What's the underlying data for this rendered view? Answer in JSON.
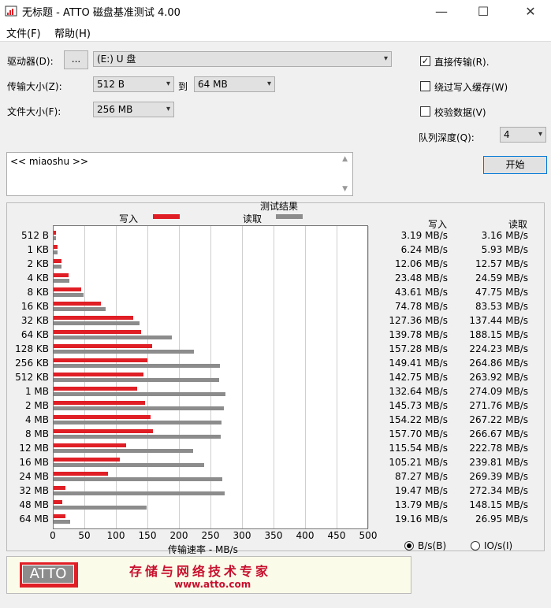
{
  "window": {
    "title": "无标题 - ATTO 磁盘基准测试 4.00",
    "minimize": "—",
    "maximize": "☐",
    "close": "✕"
  },
  "menu": {
    "file": "文件(F)",
    "help": "帮助(H)"
  },
  "drive": {
    "label": "驱动器(D):",
    "browse": "...",
    "value": "(E:) U 盘"
  },
  "transfer": {
    "label": "传输大小(Z):",
    "from": "512 B",
    "to_label": "到",
    "to": "64 MB"
  },
  "filesize": {
    "label": "文件大小(F):",
    "value": "256 MB"
  },
  "options": {
    "direct": {
      "label": "直接传输(R).",
      "checked": true
    },
    "bypass": {
      "label": "绕过写入缓存(W)",
      "checked": false
    },
    "verify": {
      "label": "校验数据(V)",
      "checked": false
    },
    "queue_label": "队列深度(Q):",
    "queue_value": "4",
    "start": "开始"
  },
  "notes": "<< miaoshu >>",
  "results": {
    "title": "测试结果",
    "legend_write": "写入",
    "legend_read": "读取",
    "col_write": "写入",
    "col_read": "读取",
    "xaxis_label": "传输速率 - MB/s",
    "unit_bs": "B/s(B)",
    "unit_ios": "IO/s(I)",
    "colors": {
      "write": "#e01e25",
      "read": "#8c8c8c"
    }
  },
  "chart_data": {
    "type": "bar",
    "orientation": "horizontal",
    "categories": [
      "512 B",
      "1 KB",
      "2 KB",
      "4 KB",
      "8 KB",
      "16 KB",
      "32 KB",
      "64 KB",
      "128 KB",
      "256 KB",
      "512 KB",
      "1 MB",
      "2 MB",
      "4 MB",
      "8 MB",
      "12 MB",
      "16 MB",
      "24 MB",
      "32 MB",
      "48 MB",
      "64 MB"
    ],
    "series": [
      {
        "name": "写入",
        "values": [
          3.19,
          6.24,
          12.06,
          23.48,
          43.61,
          74.78,
          127.36,
          139.78,
          157.28,
          149.41,
          142.75,
          132.64,
          145.73,
          154.22,
          157.7,
          115.54,
          105.21,
          87.27,
          19.47,
          13.79,
          19.16
        ]
      },
      {
        "name": "读取",
        "values": [
          3.16,
          5.93,
          12.57,
          24.59,
          47.75,
          83.53,
          137.44,
          188.15,
          224.23,
          264.86,
          263.92,
          274.09,
          271.76,
          267.22,
          266.67,
          222.78,
          239.81,
          269.39,
          272.34,
          148.15,
          26.95
        ]
      }
    ],
    "write_labels": [
      "3.19 MB/s",
      "6.24 MB/s",
      "12.06 MB/s",
      "23.48 MB/s",
      "43.61 MB/s",
      "74.78 MB/s",
      "127.36 MB/s",
      "139.78 MB/s",
      "157.28 MB/s",
      "149.41 MB/s",
      "142.75 MB/s",
      "132.64 MB/s",
      "145.73 MB/s",
      "154.22 MB/s",
      "157.70 MB/s",
      "115.54 MB/s",
      "105.21 MB/s",
      "87.27 MB/s",
      "19.47 MB/s",
      "13.79 MB/s",
      "19.16 MB/s"
    ],
    "read_labels": [
      "3.16 MB/s",
      "5.93 MB/s",
      "12.57 MB/s",
      "24.59 MB/s",
      "47.75 MB/s",
      "83.53 MB/s",
      "137.44 MB/s",
      "188.15 MB/s",
      "224.23 MB/s",
      "264.86 MB/s",
      "263.92 MB/s",
      "274.09 MB/s",
      "271.76 MB/s",
      "267.22 MB/s",
      "266.67 MB/s",
      "222.78 MB/s",
      "239.81 MB/s",
      "269.39 MB/s",
      "272.34 MB/s",
      "148.15 MB/s",
      "26.95 MB/s"
    ],
    "xticks": [
      "0",
      "50",
      "100",
      "150",
      "200",
      "250",
      "300",
      "350",
      "400",
      "450",
      "500"
    ],
    "xlim": [
      0,
      500
    ],
    "xlabel": "传输速率 - MB/s",
    "grid": true
  },
  "banner": {
    "logo": "ATTO",
    "slogan": "存储与网络技术专家",
    "url": "www.atto.com"
  }
}
